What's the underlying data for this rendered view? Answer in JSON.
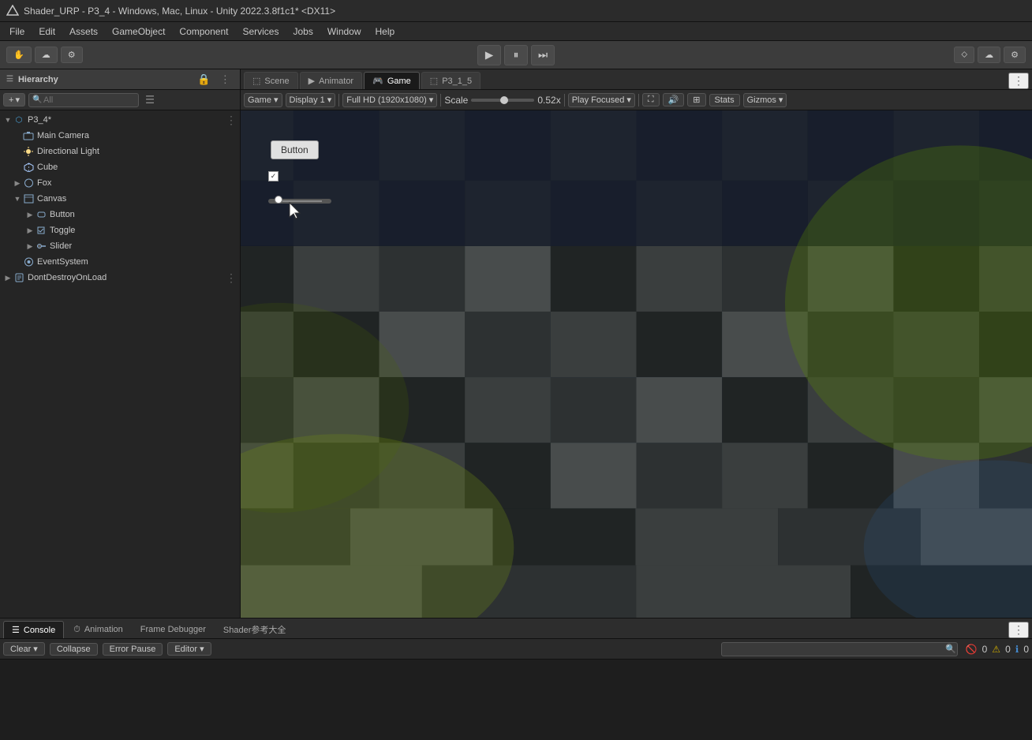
{
  "titlebar": {
    "text": "Shader_URP - P3_4 - Windows, Mac, Linux - Unity 2022.3.8f1c1* <DX11>"
  },
  "menubar": {
    "items": [
      "File",
      "Edit",
      "Assets",
      "GameObject",
      "Component",
      "Services",
      "Jobs",
      "Window",
      "Help"
    ]
  },
  "toolbar": {
    "left_buttons": [
      "⬧",
      "⊕",
      "⚙"
    ],
    "play_label": "▶",
    "pause_label": "⏸",
    "step_label": "⏭",
    "right_tools": [
      "clouds",
      "settings"
    ]
  },
  "hierarchy": {
    "title": "Hierarchy",
    "search_placeholder": "All",
    "items": [
      {
        "label": "P3_4*",
        "indent": 0,
        "arrow": "▼",
        "icon": "🎯",
        "has_dots": true
      },
      {
        "label": "Main Camera",
        "indent": 1,
        "arrow": "",
        "icon": "📷"
      },
      {
        "label": "Directional Light",
        "indent": 1,
        "arrow": "",
        "icon": "💡"
      },
      {
        "label": "Cube",
        "indent": 1,
        "arrow": "",
        "icon": "⬜"
      },
      {
        "label": "Fox",
        "indent": 1,
        "arrow": "▶",
        "icon": "🦊"
      },
      {
        "label": "Canvas",
        "indent": 1,
        "arrow": "▼",
        "icon": "🖼"
      },
      {
        "label": "Button",
        "indent": 2,
        "arrow": "▶",
        "icon": "⬜"
      },
      {
        "label": "Toggle",
        "indent": 2,
        "arrow": "▶",
        "icon": "☑"
      },
      {
        "label": "Slider",
        "indent": 2,
        "arrow": "▶",
        "icon": "🔲"
      },
      {
        "label": "EventSystem",
        "indent": 1,
        "arrow": "",
        "icon": "⚡"
      },
      {
        "label": "DontDestroyOnLoad",
        "indent": 0,
        "arrow": "▶",
        "icon": "🔒",
        "has_dots": true
      }
    ]
  },
  "tabs": {
    "scene_tabs": [
      {
        "label": "Scene",
        "icon": "⬚",
        "active": false
      },
      {
        "label": "Animator",
        "icon": "▶",
        "active": false
      },
      {
        "label": "Game",
        "icon": "🎮",
        "active": true
      },
      {
        "label": "P3_1_5",
        "icon": "⬚",
        "active": false
      }
    ]
  },
  "game_toolbar": {
    "display_label": "Game",
    "display_dropdown": "Display 1",
    "resolution_label": "Full HD (1920x1080)",
    "scale_label": "Scale",
    "scale_value": "0.52x",
    "play_focused_label": "Play Focused",
    "maximize_icon": "⛶",
    "audio_icon": "🔊",
    "grid_icon": "⊞",
    "stats_label": "Stats",
    "gizmos_label": "Gizmos"
  },
  "game_viewport": {
    "button_label": "Button",
    "toggle_checked": true,
    "toggle_label": "",
    "slider_value": 0.12
  },
  "bottom_panel": {
    "tabs": [
      {
        "label": "Console",
        "icon": "📋",
        "active": true
      },
      {
        "label": "Animation",
        "icon": "⏱",
        "active": false
      },
      {
        "label": "Frame Debugger",
        "active": false
      },
      {
        "label": "Shader参考大全",
        "active": false
      }
    ],
    "toolbar": {
      "clear_label": "Clear",
      "collapse_label": "Collapse",
      "error_pause_label": "Error Pause",
      "editor_label": "Editor"
    },
    "status_bar": {
      "error_count": "0",
      "warning_count": "0",
      "info_count": "0"
    }
  }
}
